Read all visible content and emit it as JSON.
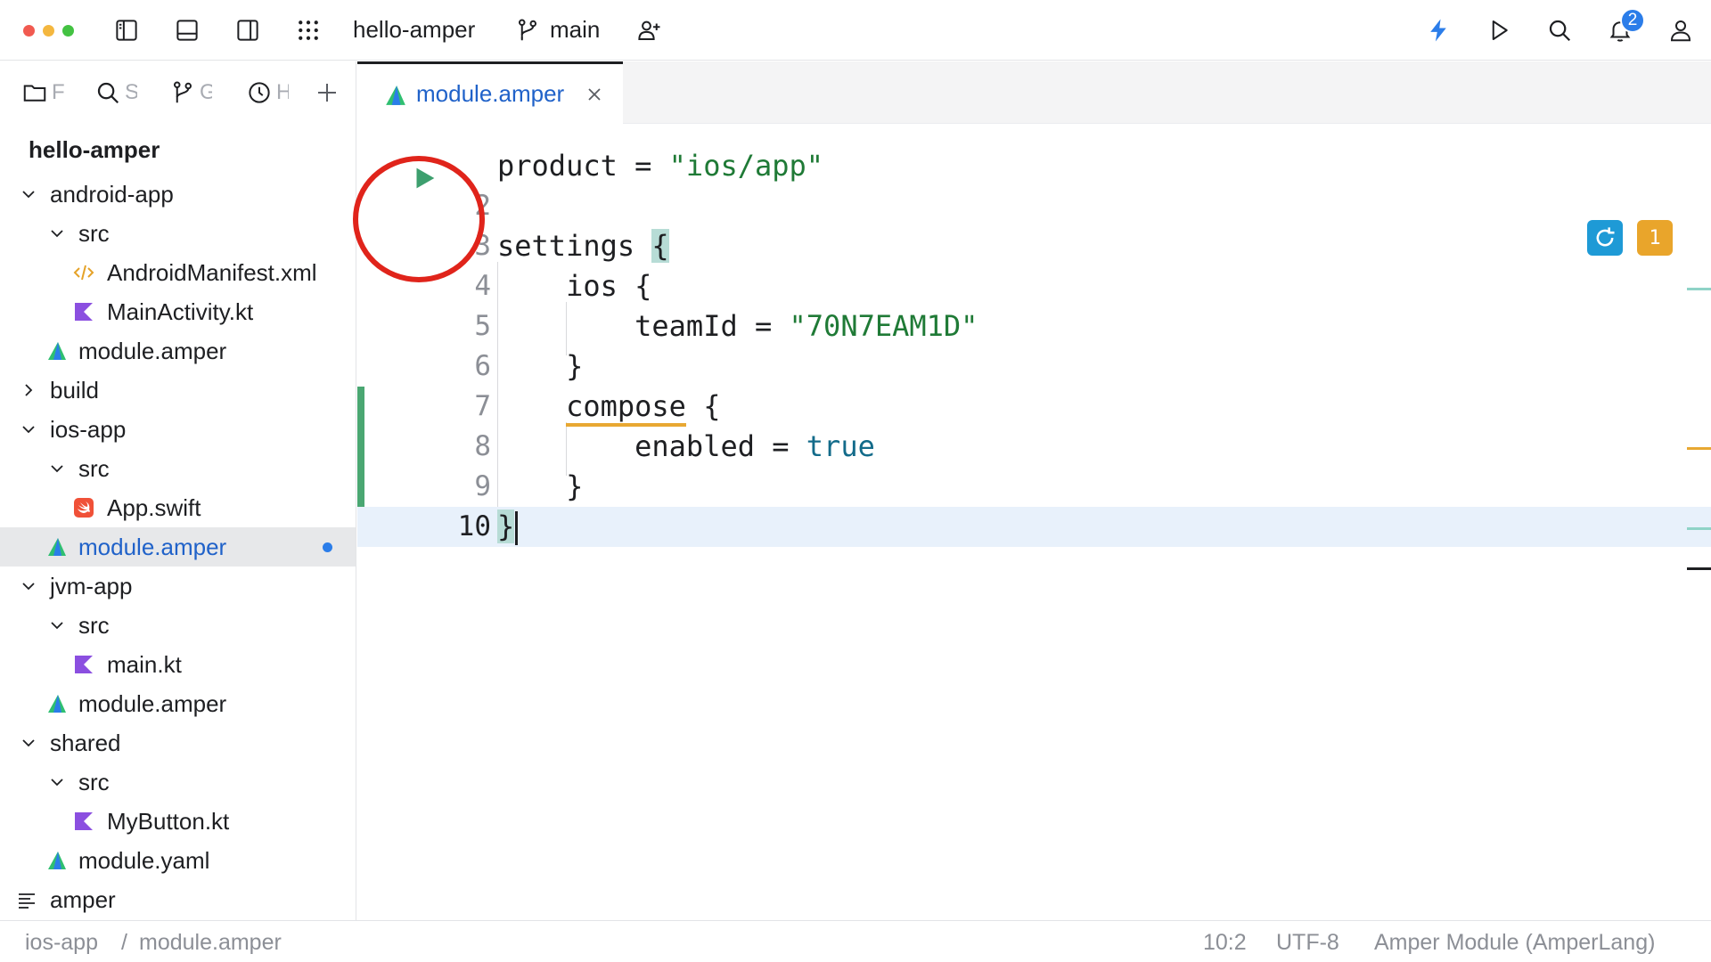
{
  "toolbar": {
    "project_name": "hello-amper",
    "branch": "main",
    "notification_count": "2",
    "colors": {
      "close": "#f15a50",
      "minimize": "#f4b73f",
      "zoom": "#43c242",
      "run_accent": "#2b7de9"
    },
    "icons": [
      "left-panel-icon",
      "bottom-panel-icon",
      "right-panel-icon",
      "apps-grid-icon",
      "branch-icon",
      "add-user-icon",
      "lightning-icon",
      "run-icon",
      "search-icon",
      "bell-icon",
      "profile-icon"
    ]
  },
  "sidebar": {
    "tabs": [
      {
        "icon": "folder-icon",
        "label": "F"
      },
      {
        "icon": "search-icon",
        "label": "S"
      },
      {
        "icon": "branch-icon",
        "label": "G"
      },
      {
        "icon": "clock-icon",
        "label": "H"
      }
    ],
    "project_title": "hello-amper",
    "tree": [
      {
        "label": "android-app",
        "icon": "none",
        "expanded": true
      },
      {
        "label": "src",
        "icon": "none",
        "expanded": true
      },
      {
        "label": "AndroidManifest.xml",
        "icon": "xml-icon"
      },
      {
        "label": "MainActivity.kt",
        "icon": "kotlin-icon"
      },
      {
        "label": "module.amper",
        "icon": "amper-icon"
      },
      {
        "label": "build",
        "icon": "none",
        "expanded": false
      },
      {
        "label": "ios-app",
        "icon": "none",
        "expanded": true
      },
      {
        "label": "src",
        "icon": "none",
        "expanded": true
      },
      {
        "label": "App.swift",
        "icon": "swift-icon"
      },
      {
        "label": "module.amper",
        "icon": "amper-icon",
        "selected": true,
        "modified": true
      },
      {
        "label": "jvm-app",
        "icon": "none",
        "expanded": true
      },
      {
        "label": "src",
        "icon": "none",
        "expanded": true
      },
      {
        "label": "main.kt",
        "icon": "kotlin-icon"
      },
      {
        "label": "module.amper",
        "icon": "amper-icon"
      },
      {
        "label": "shared",
        "icon": "none",
        "expanded": true
      },
      {
        "label": "src",
        "icon": "none",
        "expanded": true
      },
      {
        "label": "MyButton.kt",
        "icon": "kotlin-icon"
      },
      {
        "label": "module.yaml",
        "icon": "amper-icon"
      },
      {
        "label": "amper",
        "icon": "text-lines-icon"
      }
    ]
  },
  "editor": {
    "tab_label": "module.amper",
    "line_numbers": [
      "2",
      "3",
      "4",
      "5",
      "6",
      "7",
      "8",
      "9",
      "10"
    ],
    "code": {
      "l1_key": "product",
      "l1_eq": " = ",
      "l1_value": "\"ios/app\"",
      "l3_key": "settings ",
      "l3_brace": "{",
      "l4": "    ios {",
      "l5_key": "        teamId = ",
      "l5_value": "\"70N7EAM1D\"",
      "l6": "    }",
      "l7_key": "compose",
      "l7_brace": " {",
      "l8_key": "        enabled = ",
      "l8_value": "true",
      "l9": "    }",
      "l10": "}"
    },
    "problem_count": "1",
    "colors": {
      "string": "#1f7a36",
      "keyword": "#136b8a",
      "annotation_circle": "#e0241b",
      "change_marker": "#4aa772",
      "warning": "#e8a832"
    }
  },
  "statusbar": {
    "breadcrumb_1": "ios-app",
    "separator": "/",
    "breadcrumb_2": "module.amper",
    "position": "10:2",
    "encoding": "UTF-8",
    "language": "Amper Module (AmperLang)"
  }
}
